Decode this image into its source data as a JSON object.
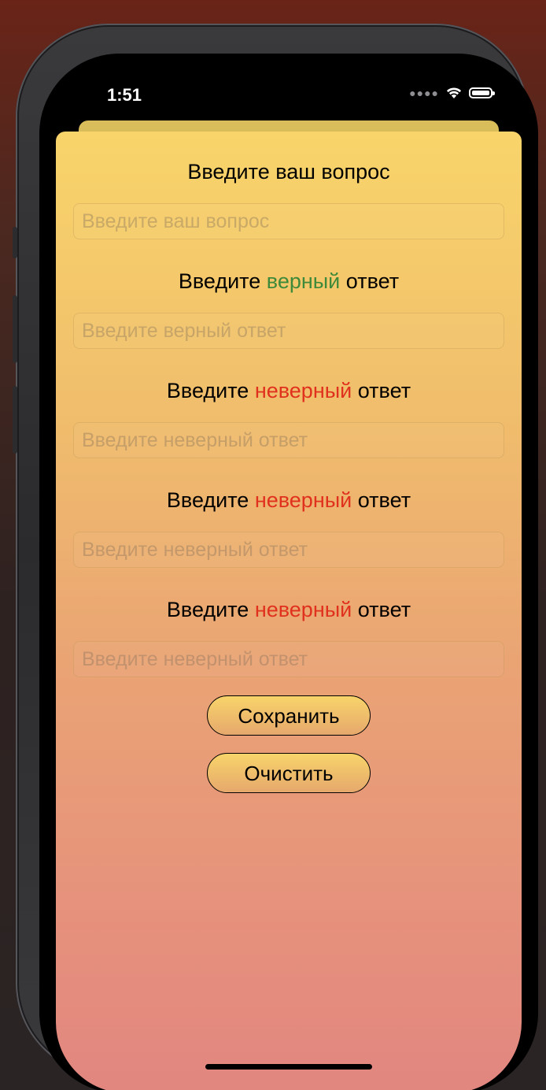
{
  "status_bar": {
    "time": "1:51",
    "cellular_icon": "cellular-dots-icon",
    "wifi_icon": "wifi-icon",
    "battery_icon": "battery-icon"
  },
  "colors": {
    "correct_accent": "#3e8a3a",
    "wrong_accent": "#e0301e",
    "gradient_top": "#f8d46a",
    "gradient_bottom": "#e28680"
  },
  "form": {
    "question": {
      "label": "Введите ваш вопрос",
      "placeholder": "Введите ваш вопрос",
      "value": ""
    },
    "correct": {
      "label_prefix": "Введите",
      "label_accent": "верный",
      "label_suffix": "ответ",
      "placeholder": "Введите верный ответ",
      "value": ""
    },
    "wrong_answers": [
      {
        "label_prefix": "Введите",
        "label_accent": "неверный",
        "label_suffix": "ответ",
        "placeholder": "Введите неверный ответ",
        "value": ""
      },
      {
        "label_prefix": "Введите",
        "label_accent": "неверный",
        "label_suffix": "ответ",
        "placeholder": "Введите неверный ответ",
        "value": ""
      },
      {
        "label_prefix": "Введите",
        "label_accent": "неверный",
        "label_suffix": "ответ",
        "placeholder": "Введите неверный ответ",
        "value": ""
      }
    ]
  },
  "actions": {
    "save_label": "Сохранить",
    "clear_label": "Очистить"
  }
}
